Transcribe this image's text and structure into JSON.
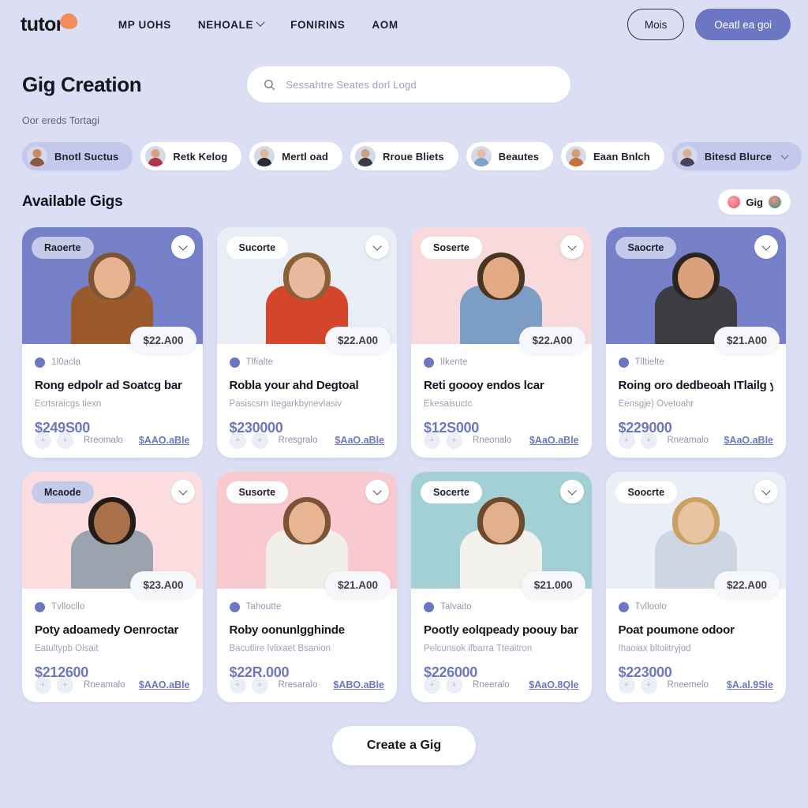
{
  "header": {
    "logo_text": "tutor",
    "nav": [
      {
        "label": "MP UOHS",
        "has_chevron": false
      },
      {
        "label": "NEHOALE",
        "has_chevron": true
      },
      {
        "label": "FONIRINS",
        "has_chevron": false
      },
      {
        "label": "AOM",
        "has_chevron": false
      }
    ],
    "ghost_button": "Mois",
    "primary_button": "Oeatl ea goi"
  },
  "page": {
    "title": "Gig Creation",
    "subtitle": "Oor ereds Tortagi"
  },
  "search": {
    "placeholder": "Sessahtre Seates dorl Logd",
    "icon": "search-icon"
  },
  "filters": [
    {
      "label": "Bnotl Suctus",
      "active": true,
      "chevron": false,
      "avatar": "a1"
    },
    {
      "label": "Retk Kelog",
      "active": false,
      "chevron": false,
      "avatar": "a2"
    },
    {
      "label": "Mertl oad",
      "active": false,
      "chevron": false,
      "avatar": "a3"
    },
    {
      "label": "Rroue Bliets",
      "active": false,
      "chevron": false,
      "avatar": "a4"
    },
    {
      "label": "Beautes",
      "active": false,
      "chevron": false,
      "avatar": "a5"
    },
    {
      "label": "Eaan Bnlch",
      "active": false,
      "chevron": false,
      "avatar": "a6"
    },
    {
      "label": "Bitesd Blurce",
      "active": true,
      "chevron": true,
      "avatar": "a7"
    }
  ],
  "section": {
    "title": "Available Gigs",
    "pill_label": "Gig",
    "pill_icon_left": "donut-icon",
    "pill_icon_right": "radish-icon"
  },
  "cards": [
    {
      "badge": "Raoerte",
      "badge_tint": true,
      "img_bg": "#7781c9",
      "price_tag": "$22.A00",
      "meta": "1l0acla",
      "title": "Rong edpolr ad Soatcg bar",
      "subtitle": "Ecrtsraicgs tiexn",
      "price": "$249S00",
      "foot_label": "Rreomalo",
      "foot_link": "$AAO.aBle",
      "skin": "#e8b48f",
      "hair": "#7d5534",
      "shirt": "#9a5a2e"
    },
    {
      "badge": "Sucorte",
      "badge_tint": false,
      "img_bg": "#e9edf5",
      "price_tag": "$22.A00",
      "meta": "Tlfialte",
      "title": "Robla your ahd Degtoal",
      "subtitle": "Pasiscsrn ItegarkbynevIasiv",
      "price": "$230000",
      "foot_label": "Rresgralo",
      "foot_link": "$AaO.aBle",
      "skin": "#e8b99c",
      "hair": "#8a6039",
      "shirt": "#d4462a"
    },
    {
      "badge": "Soserte",
      "badge_tint": false,
      "img_bg": "#f8dadd",
      "price_tag": "$22.A00",
      "meta": "Ilkente",
      "title": "Reti goooy endos lcar",
      "subtitle": "Ekesaisuctc",
      "price": "$12S000",
      "foot_label": "Rneonalo",
      "foot_link": "$AaO.aBle",
      "skin": "#e3aa86",
      "hair": "#4a3422",
      "shirt": "#7d9ec4"
    },
    {
      "badge": "Saocrte",
      "badge_tint": true,
      "img_bg": "#7781c9",
      "price_tag": "$21.A00",
      "meta": "Tlltielte",
      "title": "Roing oro dedbeoah ITlailg yo",
      "subtitle": "Eensgje) Ovetoahr",
      "price": "$229000",
      "foot_label": "Rneamalo",
      "foot_link": "$AaO.aBle",
      "skin": "#d9a27c",
      "hair": "#2b2520",
      "shirt": "#3c3c42"
    },
    {
      "badge": "Mcaode",
      "badge_tint": true,
      "img_bg": "#fbdde0",
      "price_tag": "$23.A00",
      "meta": "Tvllocllo",
      "title": "Poty adoamedy Oenroctar",
      "subtitle": "Eatultypb Oisait",
      "price": "$212600",
      "foot_label": "Rneamalo",
      "foot_link": "$AAO.aBle",
      "skin": "#a9714a",
      "hair": "#221b16",
      "shirt": "#9aa3ae"
    },
    {
      "badge": "Susorte",
      "badge_tint": false,
      "img_bg": "#f8c9ce",
      "price_tag": "$21.A00",
      "meta": "Tahoutte",
      "title": "Roby oonunlgghinde",
      "subtitle": "Bacutlire Ivlixaet Bsanion",
      "price": "$22R.000",
      "foot_label": "Rresaralo",
      "foot_link": "$ABO.aBle",
      "skin": "#e8b594",
      "hair": "#7b5335",
      "shirt": "#f0efea"
    },
    {
      "badge": "Socerte",
      "badge_tint": false,
      "img_bg": "#a3d0d4",
      "price_tag": "$21.000",
      "meta": "Talvaito",
      "title": "Pootly eolqpeady poouy bar",
      "subtitle": "Pelcunsok ifbarra Tteaitron",
      "price": "$226000",
      "foot_label": "Rneeralo",
      "foot_link": "$AaO.8Qle",
      "skin": "#e3b08e",
      "hair": "#6d4a2e",
      "shirt": "#f2f1ec"
    },
    {
      "badge": "Soocrte",
      "badge_tint": false,
      "img_bg": "#eaeef6",
      "price_tag": "$22.A00",
      "meta": "Tvlloolo",
      "title": "Poat poumone odoor",
      "subtitle": "Ihaoiax bltoiitryjod",
      "price": "$223000",
      "foot_label": "Rneemelo",
      "foot_link": "$A.al.9Sle",
      "skin": "#e9c4a3",
      "hair": "#c9a263",
      "shirt": "#cdd6e2"
    }
  ],
  "cta": {
    "label": "Create a Gig"
  },
  "colors": {
    "background": "#dcdff4",
    "primary": "#6c77c4",
    "accent_orange": "#f08c5e",
    "card": "#ffffff",
    "chip_active": "#c3c8ec"
  }
}
